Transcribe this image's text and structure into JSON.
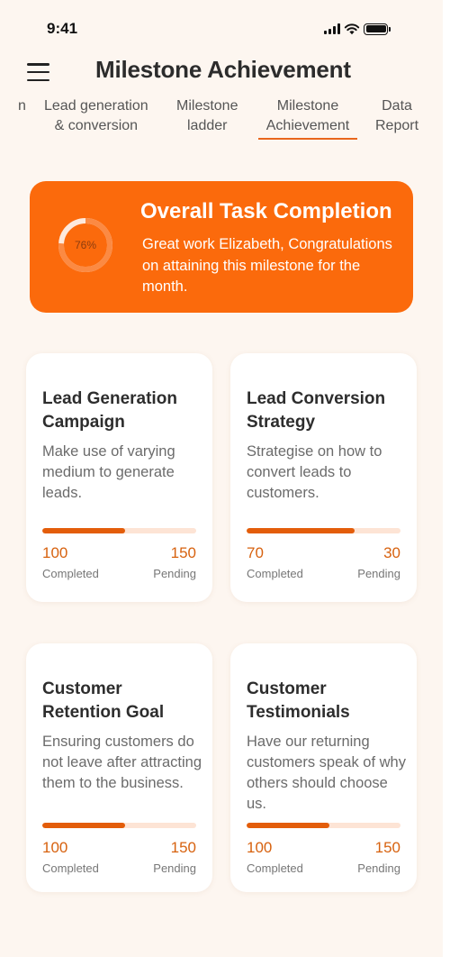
{
  "status_bar": {
    "time": "9:41"
  },
  "header": {
    "title": "Milestone Achievement"
  },
  "tabs": [
    {
      "line1": "n",
      "line2": ""
    },
    {
      "line1": "Lead generation",
      "line2": "& conversion"
    },
    {
      "line1": "Milestone",
      "line2": "ladder"
    },
    {
      "line1": "Milestone",
      "line2": "Achievement",
      "active": true
    },
    {
      "line1": "Data",
      "line2": "Report"
    }
  ],
  "overall": {
    "title": "Overall Task Completion",
    "percent_label": "76%",
    "percent": 0.76,
    "message": "Great work Elizabeth, Congratulations on attaining this milestone for the month."
  },
  "cards": [
    {
      "title": "Lead Generation Campaign",
      "description": "Make use of varying medium to generate leads.",
      "progress": 0.54,
      "completed": "100",
      "pending": "150",
      "completed_label": "Completed",
      "pending_label": "Pending"
    },
    {
      "title": "Lead Conversion Strategy",
      "description": "Strategise on how to convert leads to customers.",
      "progress": 0.7,
      "completed": "70",
      "pending": "30",
      "completed_label": "Completed",
      "pending_label": "Pending"
    },
    {
      "title": "Customer Retention Goal",
      "description": "Ensuring customers do not leave after attracting them to the business.",
      "progress": 0.54,
      "completed": "100",
      "pending": "150",
      "completed_label": "Completed",
      "pending_label": "Pending"
    },
    {
      "title": "Customer Testimonials",
      "description": "Have our returning customers speak of why others should choose us.",
      "progress": 0.54,
      "completed": "100",
      "pending": "150",
      "completed_label": "Completed",
      "pending_label": "Pending"
    }
  ],
  "icons": {
    "menu": "hamburger-menu-icon",
    "signal": "cellular-signal-icon",
    "wifi": "wifi-icon",
    "battery": "battery-icon"
  },
  "colors": {
    "accent": "#fb6a0c",
    "progress_fill": "#e35d0a",
    "progress_track": "#fde4d5",
    "background": "#fdf6f0"
  }
}
